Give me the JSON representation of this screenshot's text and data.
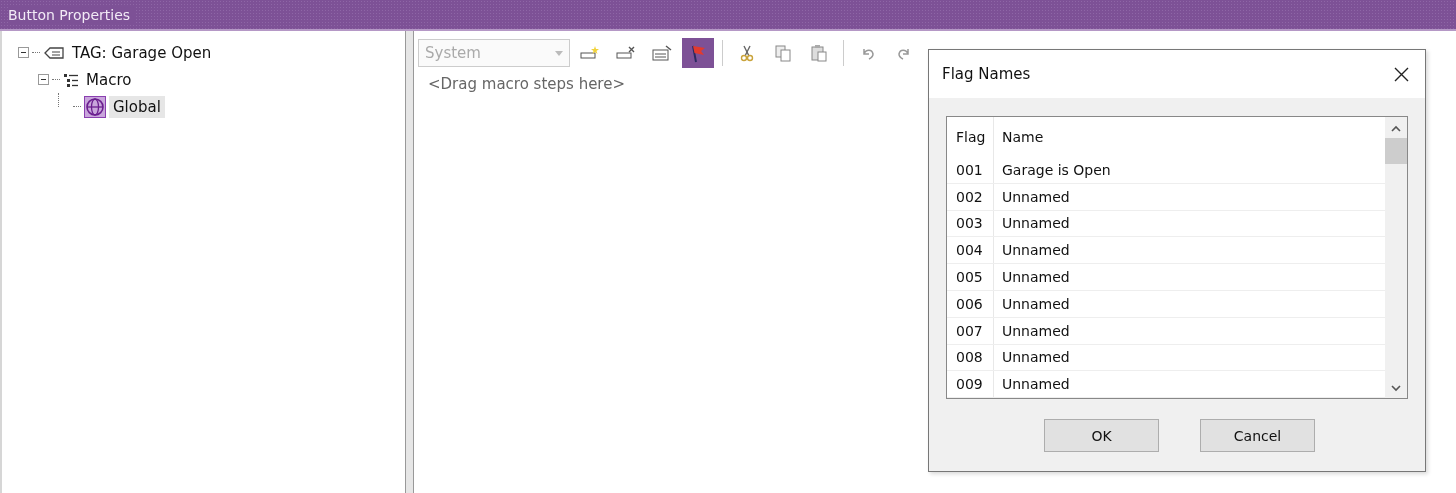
{
  "window": {
    "title": "Button Properties"
  },
  "tree": [
    {
      "label": "TAG: Garage Open",
      "kind": "tag",
      "expanded": true,
      "selected": false,
      "children": [
        {
          "label": "Macro",
          "kind": "macro",
          "expanded": true,
          "selected": false,
          "children": [
            {
              "label": "Global",
              "kind": "global",
              "selected": true
            }
          ]
        }
      ]
    }
  ],
  "toolbar": {
    "dropdown": {
      "value": "System",
      "disabled": true
    },
    "groups": [
      [
        {
          "kind": "add",
          "selected": false
        },
        {
          "kind": "remove",
          "selected": false
        },
        {
          "kind": "edit",
          "selected": false
        },
        {
          "kind": "flag",
          "selected": true
        }
      ],
      [
        {
          "kind": "cut",
          "selected": false
        },
        {
          "kind": "copy",
          "selected": false
        },
        {
          "kind": "paste",
          "selected": false
        }
      ],
      [
        {
          "kind": "undo",
          "selected": false
        },
        {
          "kind": "redo",
          "selected": false
        }
      ]
    ]
  },
  "steps_placeholder": "<Drag macro steps here>",
  "dialog": {
    "title": "Flag Names",
    "columns": [
      "Flag",
      "Name"
    ],
    "rows": [
      {
        "flag": "001",
        "name": "Garage is Open"
      },
      {
        "flag": "002",
        "name": "Unnamed"
      },
      {
        "flag": "003",
        "name": "Unnamed"
      },
      {
        "flag": "004",
        "name": "Unnamed"
      },
      {
        "flag": "005",
        "name": "Unnamed"
      },
      {
        "flag": "006",
        "name": "Unnamed"
      },
      {
        "flag": "007",
        "name": "Unnamed"
      },
      {
        "flag": "008",
        "name": "Unnamed"
      },
      {
        "flag": "009",
        "name": "Unnamed"
      }
    ],
    "buttons": [
      "OK",
      "Cancel"
    ]
  }
}
